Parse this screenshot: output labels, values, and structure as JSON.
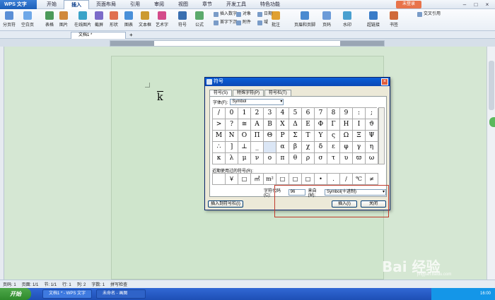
{
  "app": {
    "name": "WPS 文字",
    "menu_tabs": [
      "开始",
      "插入",
      "页面布局",
      "引用",
      "审阅",
      "视图",
      "章节",
      "开发工具",
      "特色功能"
    ],
    "active_tab": "插入",
    "login": "未登录"
  },
  "ribbon": {
    "items": [
      "分页符",
      "空白页",
      "表格",
      "图片",
      "在线图片",
      "截屏",
      "形状",
      "图表",
      "文本框",
      "艺术字",
      "符号",
      "公式",
      "批注",
      "页眉和页脚",
      "页码",
      "水印",
      "超链接",
      "书签"
    ],
    "small": [
      "插入数字",
      "对象",
      "日期",
      "首字下沉",
      "附件",
      "域",
      "交叉引用"
    ]
  },
  "doc_tab": {
    "label": "文档1 *"
  },
  "document": {
    "content": "k"
  },
  "dialog": {
    "title": "符号",
    "tabs": [
      "符号(S)",
      "特殊字符(P)",
      "符号栏(T)"
    ],
    "font_label": "字体(F):",
    "font_value": "Symbol",
    "symbols": [
      [
        "/",
        "0",
        "1",
        "2",
        "3",
        "4",
        "5",
        "6",
        "7",
        "8",
        "9",
        ":",
        ";",
        "<",
        "="
      ],
      [
        ">",
        "?",
        "≅",
        "Α",
        "Β",
        "Χ",
        "Δ",
        "Ε",
        "Φ",
        "Γ",
        "Η",
        "Ι",
        "ϑ",
        "Κ",
        "Λ"
      ],
      [
        "Μ",
        "Ν",
        "Ο",
        "Π",
        "Θ",
        "Ρ",
        "Σ",
        "Τ",
        "Υ",
        "ς",
        "Ω",
        "Ξ",
        "Ψ",
        "Ζ",
        "["
      ],
      [
        "∴",
        "]",
        "⊥",
        "_",
        "",
        "α",
        "β",
        "χ",
        "δ",
        "ε",
        "φ",
        "γ",
        "η",
        "ι",
        "φ"
      ],
      [
        "κ",
        "λ",
        "μ",
        "ν",
        "ο",
        "π",
        "θ",
        "ρ",
        "σ",
        "τ",
        "υ",
        "ϖ",
        "ω",
        "ξ",
        "ψ"
      ]
    ],
    "recent_label": "近期使用过的符号(R):",
    "recent": [
      "",
      "￥",
      "□",
      "㎡",
      "m²",
      "□",
      "□",
      "□",
      "•",
      ".",
      "/",
      "℃",
      "≠",
      "¥",
      "①"
    ],
    "charcode_label": "字符代码(C):",
    "charcode_value": "96",
    "from_label": "来自(M):",
    "from_value": "Symbol(十进制)",
    "insert_to_bar": "插入到符号栏(I)",
    "insert_btn": "插入(I)",
    "close_btn": "关闭"
  },
  "statusbar": {
    "items": [
      "页码: 1",
      "页面: 1/1",
      "节: 1/1",
      "行: 1",
      "列: 2",
      "字数: 1",
      "拼写检查"
    ]
  },
  "taskbar": {
    "start": "开始",
    "items": [
      "文档1 * - WPS 文字",
      "未命名 - 画图"
    ],
    "tray_time": "16:00"
  },
  "watermark": {
    "text": "Bai 经验",
    "sub": "jingyan.baidu.com"
  }
}
